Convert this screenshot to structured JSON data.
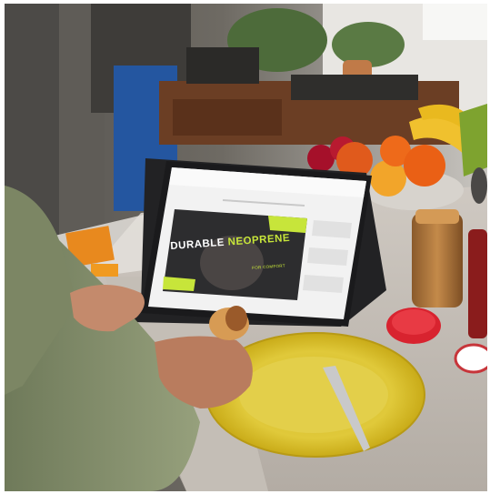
{
  "screen_ad": {
    "headline_word1": "DURABLE",
    "headline_word2": "NEOPRENE",
    "subline": "FOR COMFORT"
  },
  "colors": {
    "accent_green": "#c7e53a",
    "plate_yellow": "#d9c22b",
    "jar_lid_red": "#d8232f"
  }
}
